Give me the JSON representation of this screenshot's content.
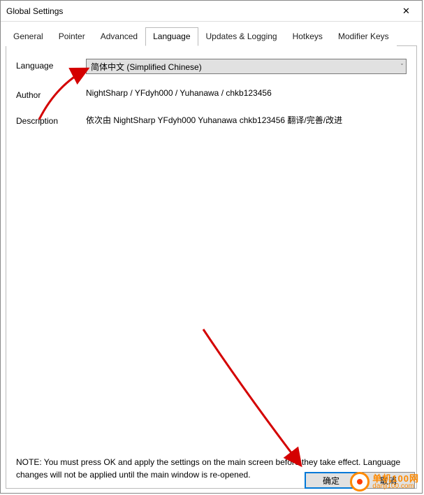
{
  "window": {
    "title": "Global Settings",
    "close_glyph": "✕"
  },
  "tabs": [
    {
      "label": "General",
      "active": false
    },
    {
      "label": "Pointer",
      "active": false
    },
    {
      "label": "Advanced",
      "active": false
    },
    {
      "label": "Language",
      "active": true
    },
    {
      "label": "Updates & Logging",
      "active": false
    },
    {
      "label": "Hotkeys",
      "active": false
    },
    {
      "label": "Modifier Keys",
      "active": false
    }
  ],
  "fields": {
    "language_label": "Language",
    "language_value": "简体中文 (Simplified Chinese)",
    "author_label": "Author",
    "author_value": "NightSharp / YFdyh000 / Yuhanawa / chkb123456",
    "description_label": "Description",
    "description_value": "依次由 NightSharp YFdyh000 Yuhanawa chkb123456 翻译/完善/改进"
  },
  "note": "NOTE: You must press OK and apply the settings on the main screen before they take effect. Language changes will not be applied until the main window is re-opened.",
  "buttons": {
    "ok": "确定",
    "cancel": "取消"
  },
  "watermark": {
    "cn": "单机100网",
    "en": "danji100.com"
  }
}
